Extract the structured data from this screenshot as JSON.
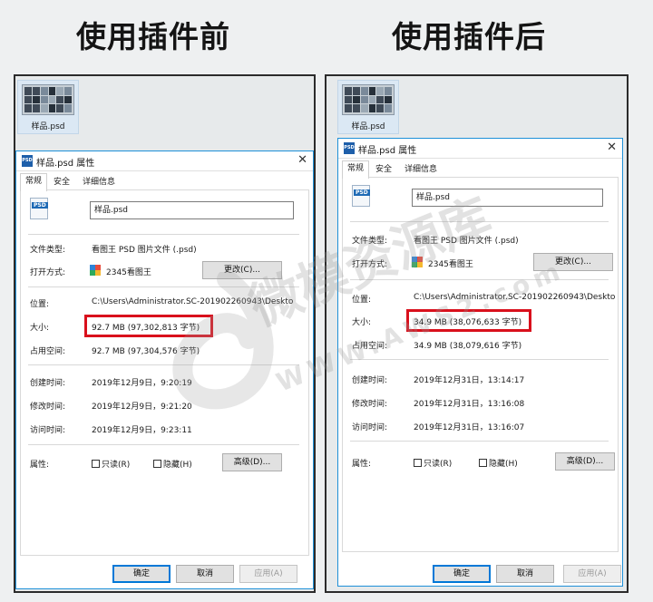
{
  "headings": {
    "before": "使用插件前",
    "after": "使用插件后"
  },
  "watermark": {
    "brand": "微模资源库",
    "site": "WWW.AWS2.com"
  },
  "before": {
    "thumb_label": "样品.psd",
    "dialog_title": "样品.psd 属性",
    "tabs": [
      "常规",
      "安全",
      "详细信息"
    ],
    "file_icon_text": "PSD",
    "file_name": "样品.psd",
    "labels": {
      "file_type": "文件类型:",
      "open_with": "打开方式:",
      "location": "位置:",
      "size": "大小:",
      "size_on_disk": "占用空间:",
      "created": "创建时间:",
      "modified": "修改时间:",
      "accessed": "访问时间:",
      "attributes": "属性:"
    },
    "values": {
      "file_type": "看图王 PSD 图片文件 (.psd)",
      "open_with": "2345看图王",
      "location": "C:\\Users\\Administrator.SC-201902260943\\Deskto",
      "size": "92.7 MB (97,302,813 字节)",
      "size_on_disk": "92.7 MB (97,304,576 字节)",
      "created": "2019年12月9日，9:20:19",
      "modified": "2019年12月9日，9:21:20",
      "accessed": "2019年12月9日，9:23:11"
    },
    "buttons": {
      "change": "更改(C)...",
      "readonly": "只读(R)",
      "hidden": "隐藏(H)",
      "advanced": "高级(D)...",
      "ok": "确定",
      "cancel": "取消",
      "apply": "应用(A)"
    }
  },
  "after": {
    "thumb_label": "样品.psd",
    "dialog_title": "样品.psd 属性",
    "tabs": [
      "常规",
      "安全",
      "详细信息"
    ],
    "file_icon_text": "PSD",
    "file_name": "样品.psd",
    "labels": {
      "file_type": "文件类型:",
      "open_with": "打开方式:",
      "location": "位置:",
      "size": "大小:",
      "size_on_disk": "占用空间:",
      "created": "创建时间:",
      "modified": "修改时间:",
      "accessed": "访问时间:",
      "attributes": "属性:"
    },
    "values": {
      "file_type": "看图王 PSD 图片文件 (.psd)",
      "open_with": "2345看图王",
      "location": "C:\\Users\\Administrator.SC-201902260943\\Deskto",
      "size": "34.9 MB (38,076,633 字节)",
      "size_on_disk": "34.9 MB (38,079,616 字节)",
      "created": "2019年12月31日，13:14:17",
      "modified": "2019年12月31日，13:16:08",
      "accessed": "2019年12月31日，13:16:07"
    },
    "buttons": {
      "change": "更改(C)...",
      "readonly": "只读(R)",
      "hidden": "隐藏(H)",
      "advanced": "高级(D)...",
      "ok": "确定",
      "cancel": "取消",
      "apply": "应用(A)"
    }
  },
  "colors": {
    "highlight": "#d9101c",
    "title_accent": "#1e90d8",
    "primary_button_border": "#0078d7"
  }
}
